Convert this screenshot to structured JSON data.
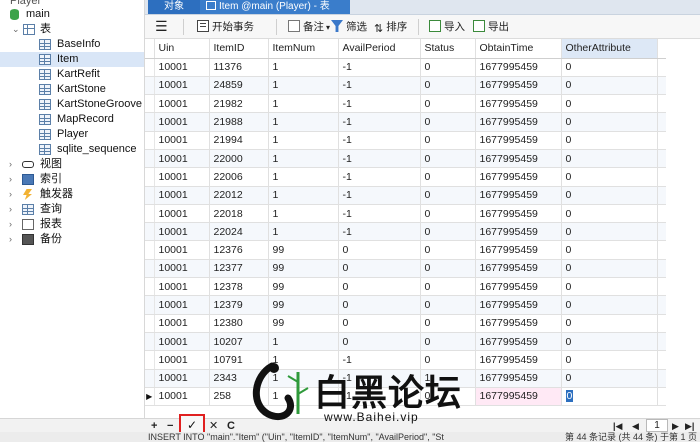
{
  "sidebar": {
    "top_item": "Player",
    "db": "main",
    "tables_node": "表",
    "tables": [
      "BaseInfo",
      "Item",
      "KartRefit",
      "KartStone",
      "KartStoneGroove",
      "MapRecord",
      "Player",
      "sqlite_sequence"
    ],
    "selected_table": "Item",
    "groups": [
      "视图",
      "索引",
      "触发器",
      "查询",
      "报表",
      "备份"
    ]
  },
  "tabs": {
    "objects": "对象",
    "doc": "Item @main (Player) - 表"
  },
  "toolbar": {
    "menu_icon": "hamburger-icon",
    "begin_tx": "开始事务",
    "note": "备注",
    "filter": "筛选",
    "sort": "排序",
    "import": "导入",
    "export": "导出"
  },
  "grid": {
    "columns": [
      "Uin",
      "ItemID",
      "ItemNum",
      "AvailPeriod",
      "Status",
      "ObtainTime",
      "OtherAttribute"
    ],
    "rows": [
      [
        "10001",
        "11376",
        "1",
        "-1",
        "0",
        "1677995459",
        "0"
      ],
      [
        "10001",
        "24859",
        "1",
        "-1",
        "0",
        "1677995459",
        "0"
      ],
      [
        "10001",
        "21982",
        "1",
        "-1",
        "0",
        "1677995459",
        "0"
      ],
      [
        "10001",
        "21988",
        "1",
        "-1",
        "0",
        "1677995459",
        "0"
      ],
      [
        "10001",
        "21994",
        "1",
        "-1",
        "0",
        "1677995459",
        "0"
      ],
      [
        "10001",
        "22000",
        "1",
        "-1",
        "0",
        "1677995459",
        "0"
      ],
      [
        "10001",
        "22006",
        "1",
        "-1",
        "0",
        "1677995459",
        "0"
      ],
      [
        "10001",
        "22012",
        "1",
        "-1",
        "0",
        "1677995459",
        "0"
      ],
      [
        "10001",
        "22018",
        "1",
        "-1",
        "0",
        "1677995459",
        "0"
      ],
      [
        "10001",
        "22024",
        "1",
        "-1",
        "0",
        "1677995459",
        "0"
      ],
      [
        "10001",
        "12376",
        "99",
        "0",
        "0",
        "1677995459",
        "0"
      ],
      [
        "10001",
        "12377",
        "99",
        "0",
        "0",
        "1677995459",
        "0"
      ],
      [
        "10001",
        "12378",
        "99",
        "0",
        "0",
        "1677995459",
        "0"
      ],
      [
        "10001",
        "12379",
        "99",
        "0",
        "0",
        "1677995459",
        "0"
      ],
      [
        "10001",
        "12380",
        "99",
        "0",
        "0",
        "1677995459",
        "0"
      ],
      [
        "10001",
        "10207",
        "1",
        "0",
        "0",
        "1677995459",
        "0"
      ],
      [
        "10001",
        "10791",
        "1",
        "-1",
        "0",
        "1677995459",
        "0"
      ],
      [
        "10001",
        "2343",
        "1",
        "-1",
        "1",
        "1677995459",
        "0"
      ],
      [
        "10001",
        "258",
        "1",
        "-1",
        "0",
        "1677995459",
        "0"
      ]
    ]
  },
  "bottombar": {
    "add": "+",
    "remove": "−",
    "confirm": "✓",
    "cancel": "✕",
    "refresh": "C",
    "page": "1"
  },
  "statusbar": {
    "sql": "INSERT INTO \"main\".\"Item\" (\"Uin\", \"ItemID\", \"ItemNum\", \"AvailPeriod\", \"St",
    "records": "第 44 条记录 (共 44 条) 于第 1 页"
  },
  "watermark": {
    "title": "白黑论坛",
    "url": "www.Baihei.vip"
  },
  "colors": {
    "accent": "#2d6fbf",
    "highlight_row": "#ffe9f5",
    "confirm_box": "#e02020"
  }
}
